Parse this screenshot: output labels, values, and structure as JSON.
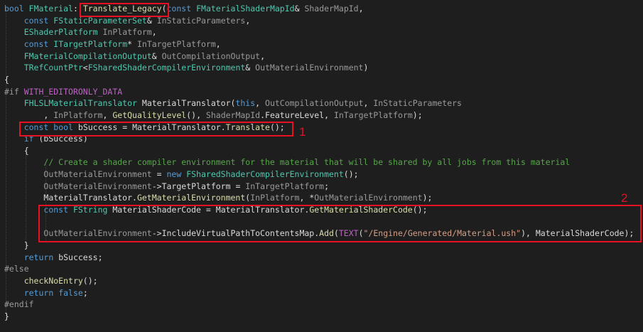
{
  "editor": {
    "language": "cpp",
    "theme": {
      "background": "#1e1e1e",
      "default": "#dcdcdc",
      "keyword": "#569cd6",
      "type": "#4ec9b0",
      "class": "#4ec9b0",
      "function": "#dcdcaa",
      "macro": "#bd63c5",
      "param": "#9a9a9a",
      "member": "#dadada",
      "string": "#d69d85",
      "comment": "#57a64a",
      "preproc": "#9b9b9b",
      "inactive_macro": "#c8c8c8",
      "annotation": "#e81123"
    },
    "lines": [
      [
        [
          "keyword",
          "bool"
        ],
        [
          "default",
          " "
        ],
        [
          "class",
          "FMaterial"
        ],
        [
          "default",
          "::"
        ],
        [
          "function",
          "Translate_Legacy"
        ],
        [
          "default",
          "("
        ],
        [
          "keyword",
          "const"
        ],
        [
          "default",
          " "
        ],
        [
          "class",
          "FMaterialShaderMapId"
        ],
        [
          "default",
          "& "
        ],
        [
          "param",
          "ShaderMapId"
        ],
        [
          "default",
          ","
        ]
      ],
      [
        [
          "default",
          "    "
        ],
        [
          "keyword",
          "const"
        ],
        [
          "default",
          " "
        ],
        [
          "class",
          "FStaticParameterSet"
        ],
        [
          "default",
          "& "
        ],
        [
          "param",
          "InStaticParameters"
        ],
        [
          "default",
          ","
        ]
      ],
      [
        [
          "default",
          "    "
        ],
        [
          "class",
          "EShaderPlatform"
        ],
        [
          "default",
          " "
        ],
        [
          "param",
          "InPlatform"
        ],
        [
          "default",
          ","
        ]
      ],
      [
        [
          "default",
          "    "
        ],
        [
          "keyword",
          "const"
        ],
        [
          "default",
          " "
        ],
        [
          "class",
          "ITargetPlatform"
        ],
        [
          "default",
          "* "
        ],
        [
          "param",
          "InTargetPlatform"
        ],
        [
          "default",
          ","
        ]
      ],
      [
        [
          "default",
          "    "
        ],
        [
          "class",
          "FMaterialCompilationOutput"
        ],
        [
          "default",
          "& "
        ],
        [
          "param",
          "OutCompilationOutput"
        ],
        [
          "default",
          ","
        ]
      ],
      [
        [
          "default",
          "    "
        ],
        [
          "class",
          "TRefCountPtr"
        ],
        [
          "default",
          "<"
        ],
        [
          "class",
          "FSharedShaderCompilerEnvironment"
        ],
        [
          "default",
          "& "
        ],
        [
          "param",
          "OutMaterialEnvironment"
        ],
        [
          "default",
          ")"
        ]
      ],
      [
        [
          "default",
          "{"
        ]
      ],
      [
        [
          "preproc",
          "#if "
        ],
        [
          "macro",
          "WITH_EDITORONLY_DATA"
        ]
      ],
      [
        [
          "default",
          "    "
        ],
        [
          "class",
          "FHLSLMaterialTranslator"
        ],
        [
          "default",
          " "
        ],
        [
          "member",
          "MaterialTranslator"
        ],
        [
          "default",
          "("
        ],
        [
          "keyword",
          "this"
        ],
        [
          "default",
          ", "
        ],
        [
          "param",
          "OutCompilationOutput"
        ],
        [
          "default",
          ", "
        ],
        [
          "param",
          "InStaticParameters"
        ]
      ],
      [
        [
          "default",
          "        , "
        ],
        [
          "param",
          "InPlatform"
        ],
        [
          "default",
          ", "
        ],
        [
          "function",
          "GetQualityLevel"
        ],
        [
          "default",
          "(), "
        ],
        [
          "param",
          "ShaderMapId"
        ],
        [
          "default",
          "."
        ],
        [
          "member",
          "FeatureLevel"
        ],
        [
          "default",
          ", "
        ],
        [
          "param",
          "InTargetPlatform"
        ],
        [
          "default",
          ");"
        ]
      ],
      [
        [
          "default",
          "    "
        ],
        [
          "keyword",
          "const"
        ],
        [
          "default",
          " "
        ],
        [
          "keyword",
          "bool"
        ],
        [
          "default",
          " "
        ],
        [
          "member",
          "bSuccess"
        ],
        [
          "default",
          " = "
        ],
        [
          "member",
          "MaterialTranslator"
        ],
        [
          "default",
          "."
        ],
        [
          "function",
          "Translate"
        ],
        [
          "default",
          "();"
        ]
      ],
      [
        [
          "default",
          "    "
        ],
        [
          "keyword",
          "if"
        ],
        [
          "default",
          " ("
        ],
        [
          "member",
          "bSuccess"
        ],
        [
          "default",
          ")"
        ]
      ],
      [
        [
          "default",
          "    {"
        ]
      ],
      [
        [
          "default",
          "        "
        ],
        [
          "comment",
          "// Create a shader compiler environment for the material that will be shared by all jobs from this material"
        ]
      ],
      [
        [
          "default",
          "        "
        ],
        [
          "param",
          "OutMaterialEnvironment"
        ],
        [
          "default",
          " = "
        ],
        [
          "keyword",
          "new"
        ],
        [
          "default",
          " "
        ],
        [
          "class",
          "FSharedShaderCompilerEnvironment"
        ],
        [
          "default",
          "();"
        ]
      ],
      [
        [
          "default",
          "        "
        ],
        [
          "param",
          "OutMaterialEnvironment"
        ],
        [
          "default",
          "->"
        ],
        [
          "member",
          "TargetPlatform"
        ],
        [
          "default",
          " = "
        ],
        [
          "param",
          "InTargetPlatform"
        ],
        [
          "default",
          ";"
        ]
      ],
      [
        [
          "default",
          "        "
        ],
        [
          "member",
          "MaterialTranslator"
        ],
        [
          "default",
          "."
        ],
        [
          "function",
          "GetMaterialEnvironment"
        ],
        [
          "default",
          "("
        ],
        [
          "param",
          "InPlatform"
        ],
        [
          "default",
          ", *"
        ],
        [
          "param",
          "OutMaterialEnvironment"
        ],
        [
          "default",
          ");"
        ]
      ],
      [
        [
          "default",
          "        "
        ],
        [
          "keyword",
          "const"
        ],
        [
          "default",
          " "
        ],
        [
          "class",
          "FString"
        ],
        [
          "default",
          " "
        ],
        [
          "member",
          "MaterialShaderCode"
        ],
        [
          "default",
          " = "
        ],
        [
          "member",
          "MaterialTranslator"
        ],
        [
          "default",
          "."
        ],
        [
          "function",
          "GetMaterialShaderCode"
        ],
        [
          "default",
          "();"
        ]
      ],
      [
        [
          "default",
          ""
        ]
      ],
      [
        [
          "default",
          "        "
        ],
        [
          "param",
          "OutMaterialEnvironment"
        ],
        [
          "default",
          "->"
        ],
        [
          "member",
          "IncludeVirtualPathToContentsMap"
        ],
        [
          "default",
          "."
        ],
        [
          "function",
          "Add"
        ],
        [
          "default",
          "("
        ],
        [
          "macro",
          "TEXT"
        ],
        [
          "default",
          "("
        ],
        [
          "string",
          "\"/Engine/Generated/Material.ush\""
        ],
        [
          "default",
          "), "
        ],
        [
          "member",
          "MaterialShaderCode"
        ],
        [
          "default",
          ");"
        ]
      ],
      [
        [
          "default",
          "    }"
        ]
      ],
      [
        [
          "default",
          "    "
        ],
        [
          "keyword",
          "return"
        ],
        [
          "default",
          " "
        ],
        [
          "member",
          "bSuccess"
        ],
        [
          "default",
          ";"
        ]
      ],
      [
        [
          "preproc",
          "#else"
        ]
      ],
      [
        [
          "default",
          "    "
        ],
        [
          "function",
          "checkNoEntry"
        ],
        [
          "default",
          "();"
        ]
      ],
      [
        [
          "default",
          "    "
        ],
        [
          "keyword",
          "return"
        ],
        [
          "default",
          " "
        ],
        [
          "keyword",
          "false"
        ],
        [
          "default",
          ";"
        ]
      ],
      [
        [
          "preproc",
          "#endif"
        ]
      ],
      [
        [
          "default",
          "}"
        ]
      ]
    ]
  },
  "annotations": [
    {
      "label": "1"
    },
    {
      "label": "2"
    }
  ]
}
